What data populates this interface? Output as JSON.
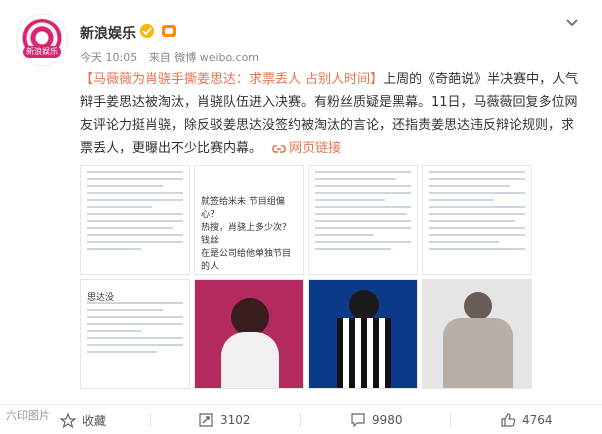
{
  "account": {
    "name": "新浪娱乐",
    "avatar_text": "新浪娱乐"
  },
  "meta": {
    "time": "今天 10:05",
    "source": "来自 微博 weibo.com"
  },
  "post": {
    "headline": "【马薇薇为肖骁手撕姜思达：求票丢人 占别人时间】",
    "body": "上周的《奇葩说》半决赛中，人气辩手姜思达被淘汰，肖骁队伍进入决赛。有粉丝质疑是黑幕。11日，马薇薇回复多位网友评论力挺肖骁，除反驳姜思达没签约被淘汰的言论，还指责姜思达违反辩论规则，求票丢人，更曝出不少比赛内幕。",
    "link_text": "网页链接"
  },
  "gallery": [
    {
      "label": "评论截图1"
    },
    {
      "label": "评论截图2"
    },
    {
      "label": "评论截图3"
    },
    {
      "label": "评论截图4"
    },
    {
      "label": "评论截图5"
    },
    {
      "label": "节目截图1"
    },
    {
      "label": "节目截图2"
    },
    {
      "label": "节目截图3"
    }
  ],
  "gallery_text": {
    "thumb2": "就签给米未 节目组偏心？\n热搜，肖骁上多少次？ 钱丝\n在是公司给他单独节目的人\n说偏心，太搞笑了。",
    "thumb5": "思达没"
  },
  "actions": {
    "favorite": "收藏",
    "repost": "3102",
    "comment": "9980",
    "like": "4764"
  },
  "watermark": "六印图片",
  "colors": {
    "accent": "#eb7350",
    "brand": "#d6246e"
  }
}
